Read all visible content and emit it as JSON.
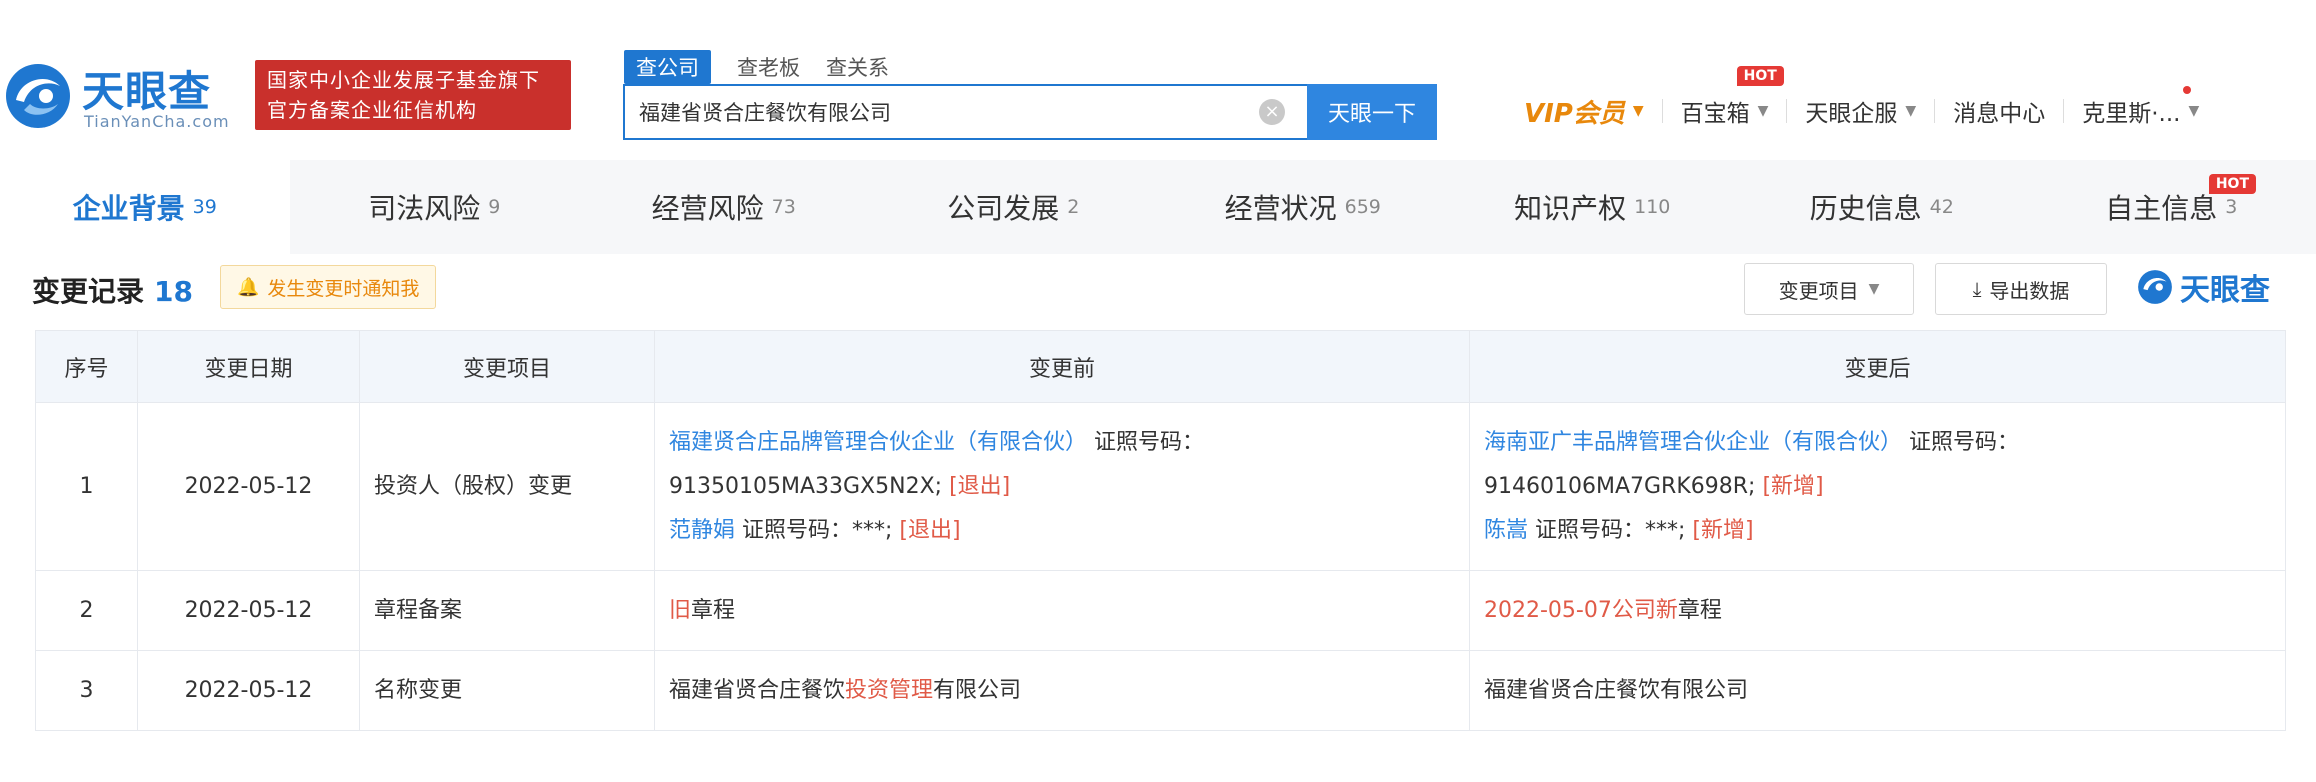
{
  "brand": {
    "name": "天眼查",
    "domain": "TianYanCha.com",
    "badge_line1": "国家中小企业发展子基金旗下",
    "badge_line2": "官方备案企业征信机构"
  },
  "search": {
    "tabs": [
      "查公司",
      "查老板",
      "查关系"
    ],
    "active_tab": 0,
    "query": "福建省贤合庄餐饮有限公司",
    "button": "天眼一下"
  },
  "topnav": {
    "vip": "VIP会员",
    "treasure": "百宝箱",
    "hot": "HOT",
    "enterprise": "天眼企服",
    "messages": "消息中心",
    "user": "克里斯·..."
  },
  "category_tabs": [
    {
      "label": "企业背景",
      "count": "39"
    },
    {
      "label": "司法风险",
      "count": "9"
    },
    {
      "label": "经营风险",
      "count": "73"
    },
    {
      "label": "公司发展",
      "count": "2"
    },
    {
      "label": "经营状况",
      "count": "659"
    },
    {
      "label": "知识产权",
      "count": "110"
    },
    {
      "label": "历史信息",
      "count": "42"
    },
    {
      "label": "自主信息",
      "count": "3",
      "hot": "HOT"
    }
  ],
  "section": {
    "title": "变更记录",
    "count": "18",
    "notify": "发生变更时通知我",
    "filter": "变更项目",
    "export": "导出数据",
    "brand": "天眼查"
  },
  "table": {
    "headers": [
      "序号",
      "变更日期",
      "变更项目",
      "变更前",
      "变更后"
    ],
    "rows": [
      {
        "index": "1",
        "date": "2022-05-12",
        "item": "投资人（股权）变更",
        "before": {
          "entity1": "福建贤合庄品牌管理合伙企业（有限合伙）",
          "cert1": " 证照号码：91350105MA33GX5N2X; ",
          "tag1": "[退出]",
          "entity2": "范静娟",
          "cert2": " 证照号码：***; ",
          "tag2": "[退出]"
        },
        "after": {
          "entity1": "海南亚广丰品牌管理合伙企业（有限合伙）",
          "cert1": " 证照号码：91460106MA7GRK698R; ",
          "tag1": "[新增]",
          "entity2": "陈嵩",
          "cert2": " 证照号码：***; ",
          "tag2": "[新增]"
        }
      },
      {
        "index": "2",
        "date": "2022-05-12",
        "item": "章程备案",
        "before": {
          "hl": "旧",
          "rest": "章程"
        },
        "after": {
          "hl": "2022-05-07公司新",
          "rest": "章程"
        }
      },
      {
        "index": "3",
        "date": "2022-05-12",
        "item": "名称变更",
        "before": {
          "pre": "福建省贤合庄餐饮",
          "hl": "投资管理",
          "post": "有限公司"
        },
        "after": {
          "text": "福建省贤合庄餐饮有限公司"
        }
      }
    ]
  },
  "colors": {
    "accent": "#1f77d0",
    "hot": "#e53935",
    "change": "#e05a47",
    "vip": "#e8880c"
  }
}
